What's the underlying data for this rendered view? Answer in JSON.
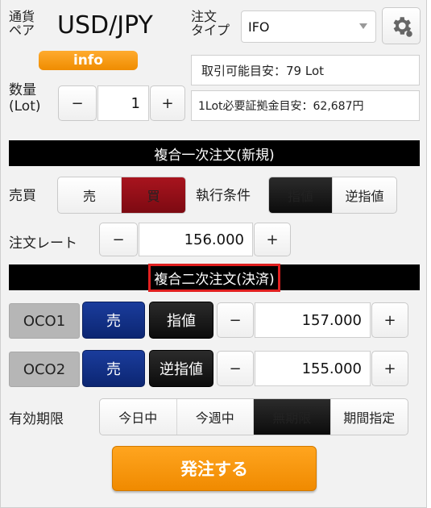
{
  "header": {
    "currency_pair_label_line1": "通貨",
    "currency_pair_label_line2": "ペア",
    "currency_pair": "USD/JPY",
    "order_type_label_line1": "注文",
    "order_type_label_line2": "タイプ",
    "order_type_value": "IFO",
    "settings_icon": "gear-icon"
  },
  "info_button": "info",
  "quantity": {
    "label_line1": "数量",
    "label_line2": "(Lot)",
    "minus": "−",
    "value": "1",
    "plus": "+"
  },
  "tradable_estimate": "取引可能目安：79 Lot",
  "margin_estimate": "1Lot必要証拠金目安：62,687円",
  "section1": {
    "title": "複合一次注文(新規)",
    "side_label": "売買",
    "sell": "売",
    "buy": "買",
    "exec_label": "執行条件",
    "limit": "指値",
    "stop": "逆指値",
    "rate_label": "注文レート",
    "rate_minus": "−",
    "rate_value": "156.000",
    "rate_plus": "+"
  },
  "section2": {
    "title": "複合二次注文(決済)",
    "oco1": {
      "label": "OCO1",
      "side": "売",
      "type": "指値",
      "minus": "−",
      "value": "157.000",
      "plus": "+"
    },
    "oco2": {
      "label": "OCO2",
      "side": "売",
      "type": "逆指値",
      "minus": "−",
      "value": "155.000",
      "plus": "+"
    }
  },
  "expiry": {
    "label": "有効期限",
    "options": [
      "今日中",
      "今週中",
      "無期限",
      "期間指定"
    ],
    "selected": "無期限"
  },
  "submit": "発注する",
  "colors": {
    "buy_red": "#8b0d15",
    "sell_blue": "#12318a",
    "accent_orange": "#f39a0d",
    "highlight_red": "#e02020"
  }
}
